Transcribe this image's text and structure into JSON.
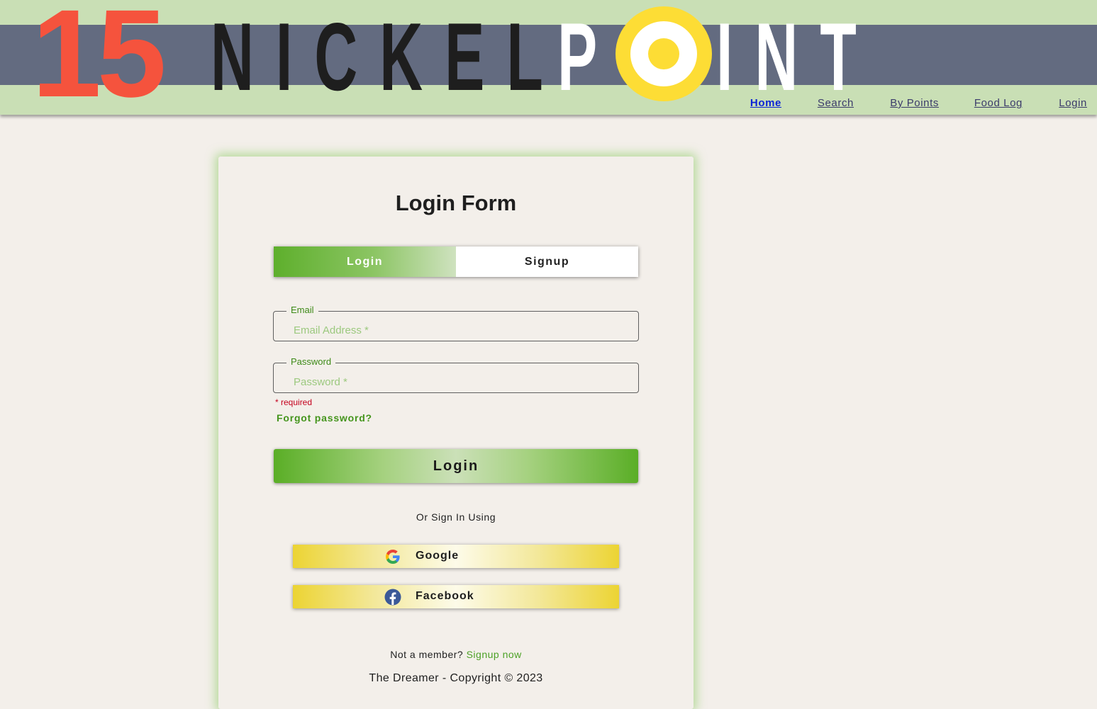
{
  "header": {
    "logo": {
      "number": "15",
      "word1": "NICKEL",
      "word2_start": "P",
      "word2_end": "INT"
    },
    "nav": [
      {
        "label": "Home",
        "active": true
      },
      {
        "label": "Search",
        "active": false
      },
      {
        "label": "By Points",
        "active": false
      },
      {
        "label": "Food Log",
        "active": false
      },
      {
        "label": "Login",
        "active": false
      }
    ]
  },
  "form": {
    "title": "Login Form",
    "tabs": {
      "login": "Login",
      "signup": "Signup"
    },
    "email": {
      "legend": "Email",
      "placeholder": "Email Address *",
      "value": ""
    },
    "password": {
      "legend": "Password",
      "placeholder": "Password *",
      "value": ""
    },
    "required_note": "* required",
    "forgot": "Forgot password?",
    "submit": "Login",
    "or_text": "Or Sign In Using",
    "social": {
      "google": "Google",
      "facebook": "Facebook"
    },
    "member_text": "Not a member?",
    "signup_link": "Signup now"
  },
  "footer": {
    "copyright": "The Dreamer - Copyright © 2023"
  },
  "colors": {
    "header_bg": "#c9dfb5",
    "header_band": "#636b80",
    "logo_number": "#f5533d",
    "logo_o": "#fddd35",
    "accent_green": "#5aae26",
    "link_active": "#0b23d6",
    "required": "#c4001d",
    "page_bg": "#f3efea"
  }
}
